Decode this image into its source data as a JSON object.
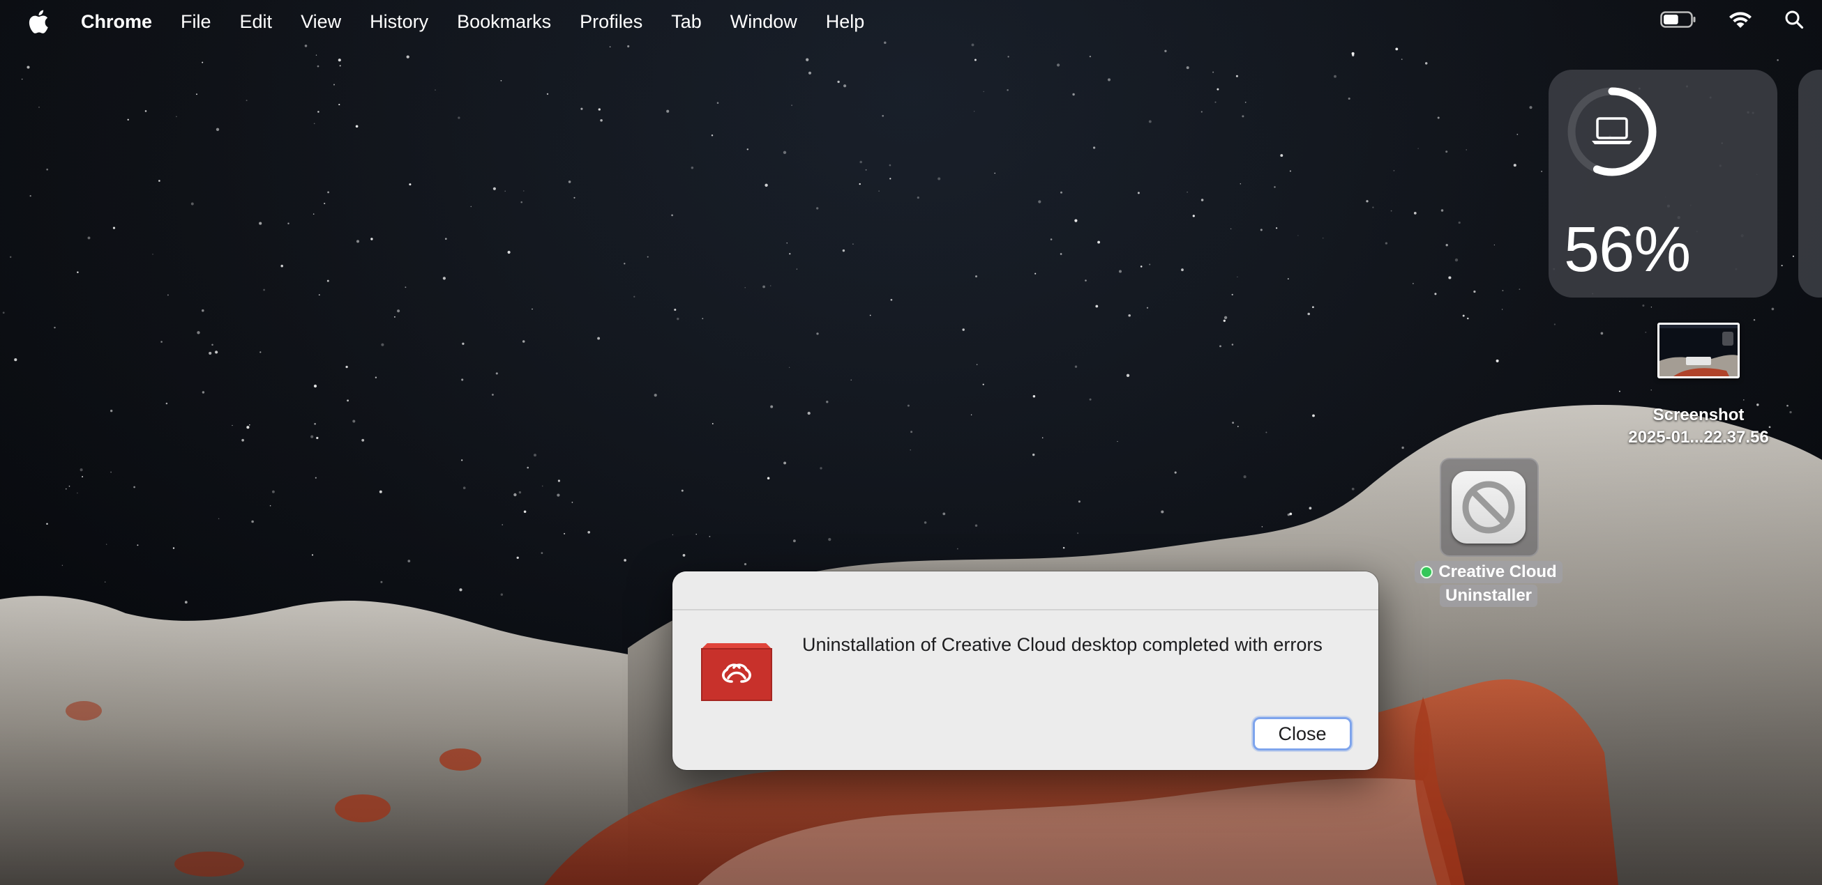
{
  "menubar": {
    "app_name": "Chrome",
    "items": [
      "File",
      "Edit",
      "View",
      "History",
      "Bookmarks",
      "Profiles",
      "Tab",
      "Window",
      "Help"
    ],
    "status_icons": [
      "battery-icon",
      "wifi-icon",
      "spotlight-search-icon"
    ]
  },
  "widget": {
    "battery_percent_text": "56%",
    "battery_level": 0.56,
    "device_icon": "laptop-icon"
  },
  "desktop": {
    "screenshot_file": {
      "label_line1": "Screenshot",
      "label_line2": "2025-01...22.37.56"
    },
    "uninstaller": {
      "label_line1": "Creative Cloud",
      "label_line2": "Uninstaller",
      "icon": "prohibited-icon",
      "status_color": "#34c759"
    }
  },
  "dialog": {
    "message": "Uninstallation of Creative Cloud desktop completed with errors",
    "close_label": "Close",
    "app_icon": "creative-cloud-icon",
    "icon_color": "#c8312b"
  }
}
